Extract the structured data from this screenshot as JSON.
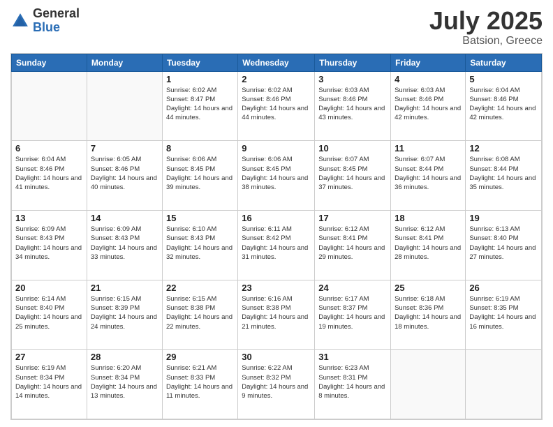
{
  "logo": {
    "general": "General",
    "blue": "Blue"
  },
  "title": {
    "month_year": "July 2025",
    "location": "Batsion, Greece"
  },
  "days_of_week": [
    "Sunday",
    "Monday",
    "Tuesday",
    "Wednesday",
    "Thursday",
    "Friday",
    "Saturday"
  ],
  "weeks": [
    [
      null,
      null,
      {
        "day": "1",
        "sunrise": "Sunrise: 6:02 AM",
        "sunset": "Sunset: 8:47 PM",
        "daylight": "Daylight: 14 hours and 44 minutes."
      },
      {
        "day": "2",
        "sunrise": "Sunrise: 6:02 AM",
        "sunset": "Sunset: 8:46 PM",
        "daylight": "Daylight: 14 hours and 44 minutes."
      },
      {
        "day": "3",
        "sunrise": "Sunrise: 6:03 AM",
        "sunset": "Sunset: 8:46 PM",
        "daylight": "Daylight: 14 hours and 43 minutes."
      },
      {
        "day": "4",
        "sunrise": "Sunrise: 6:03 AM",
        "sunset": "Sunset: 8:46 PM",
        "daylight": "Daylight: 14 hours and 42 minutes."
      },
      {
        "day": "5",
        "sunrise": "Sunrise: 6:04 AM",
        "sunset": "Sunset: 8:46 PM",
        "daylight": "Daylight: 14 hours and 42 minutes."
      }
    ],
    [
      {
        "day": "6",
        "sunrise": "Sunrise: 6:04 AM",
        "sunset": "Sunset: 8:46 PM",
        "daylight": "Daylight: 14 hours and 41 minutes."
      },
      {
        "day": "7",
        "sunrise": "Sunrise: 6:05 AM",
        "sunset": "Sunset: 8:46 PM",
        "daylight": "Daylight: 14 hours and 40 minutes."
      },
      {
        "day": "8",
        "sunrise": "Sunrise: 6:06 AM",
        "sunset": "Sunset: 8:45 PM",
        "daylight": "Daylight: 14 hours and 39 minutes."
      },
      {
        "day": "9",
        "sunrise": "Sunrise: 6:06 AM",
        "sunset": "Sunset: 8:45 PM",
        "daylight": "Daylight: 14 hours and 38 minutes."
      },
      {
        "day": "10",
        "sunrise": "Sunrise: 6:07 AM",
        "sunset": "Sunset: 8:45 PM",
        "daylight": "Daylight: 14 hours and 37 minutes."
      },
      {
        "day": "11",
        "sunrise": "Sunrise: 6:07 AM",
        "sunset": "Sunset: 8:44 PM",
        "daylight": "Daylight: 14 hours and 36 minutes."
      },
      {
        "day": "12",
        "sunrise": "Sunrise: 6:08 AM",
        "sunset": "Sunset: 8:44 PM",
        "daylight": "Daylight: 14 hours and 35 minutes."
      }
    ],
    [
      {
        "day": "13",
        "sunrise": "Sunrise: 6:09 AM",
        "sunset": "Sunset: 8:43 PM",
        "daylight": "Daylight: 14 hours and 34 minutes."
      },
      {
        "day": "14",
        "sunrise": "Sunrise: 6:09 AM",
        "sunset": "Sunset: 8:43 PM",
        "daylight": "Daylight: 14 hours and 33 minutes."
      },
      {
        "day": "15",
        "sunrise": "Sunrise: 6:10 AM",
        "sunset": "Sunset: 8:43 PM",
        "daylight": "Daylight: 14 hours and 32 minutes."
      },
      {
        "day": "16",
        "sunrise": "Sunrise: 6:11 AM",
        "sunset": "Sunset: 8:42 PM",
        "daylight": "Daylight: 14 hours and 31 minutes."
      },
      {
        "day": "17",
        "sunrise": "Sunrise: 6:12 AM",
        "sunset": "Sunset: 8:41 PM",
        "daylight": "Daylight: 14 hours and 29 minutes."
      },
      {
        "day": "18",
        "sunrise": "Sunrise: 6:12 AM",
        "sunset": "Sunset: 8:41 PM",
        "daylight": "Daylight: 14 hours and 28 minutes."
      },
      {
        "day": "19",
        "sunrise": "Sunrise: 6:13 AM",
        "sunset": "Sunset: 8:40 PM",
        "daylight": "Daylight: 14 hours and 27 minutes."
      }
    ],
    [
      {
        "day": "20",
        "sunrise": "Sunrise: 6:14 AM",
        "sunset": "Sunset: 8:40 PM",
        "daylight": "Daylight: 14 hours and 25 minutes."
      },
      {
        "day": "21",
        "sunrise": "Sunrise: 6:15 AM",
        "sunset": "Sunset: 8:39 PM",
        "daylight": "Daylight: 14 hours and 24 minutes."
      },
      {
        "day": "22",
        "sunrise": "Sunrise: 6:15 AM",
        "sunset": "Sunset: 8:38 PM",
        "daylight": "Daylight: 14 hours and 22 minutes."
      },
      {
        "day": "23",
        "sunrise": "Sunrise: 6:16 AM",
        "sunset": "Sunset: 8:38 PM",
        "daylight": "Daylight: 14 hours and 21 minutes."
      },
      {
        "day": "24",
        "sunrise": "Sunrise: 6:17 AM",
        "sunset": "Sunset: 8:37 PM",
        "daylight": "Daylight: 14 hours and 19 minutes."
      },
      {
        "day": "25",
        "sunrise": "Sunrise: 6:18 AM",
        "sunset": "Sunset: 8:36 PM",
        "daylight": "Daylight: 14 hours and 18 minutes."
      },
      {
        "day": "26",
        "sunrise": "Sunrise: 6:19 AM",
        "sunset": "Sunset: 8:35 PM",
        "daylight": "Daylight: 14 hours and 16 minutes."
      }
    ],
    [
      {
        "day": "27",
        "sunrise": "Sunrise: 6:19 AM",
        "sunset": "Sunset: 8:34 PM",
        "daylight": "Daylight: 14 hours and 14 minutes."
      },
      {
        "day": "28",
        "sunrise": "Sunrise: 6:20 AM",
        "sunset": "Sunset: 8:34 PM",
        "daylight": "Daylight: 14 hours and 13 minutes."
      },
      {
        "day": "29",
        "sunrise": "Sunrise: 6:21 AM",
        "sunset": "Sunset: 8:33 PM",
        "daylight": "Daylight: 14 hours and 11 minutes."
      },
      {
        "day": "30",
        "sunrise": "Sunrise: 6:22 AM",
        "sunset": "Sunset: 8:32 PM",
        "daylight": "Daylight: 14 hours and 9 minutes."
      },
      {
        "day": "31",
        "sunrise": "Sunrise: 6:23 AM",
        "sunset": "Sunset: 8:31 PM",
        "daylight": "Daylight: 14 hours and 8 minutes."
      },
      null,
      null
    ]
  ]
}
